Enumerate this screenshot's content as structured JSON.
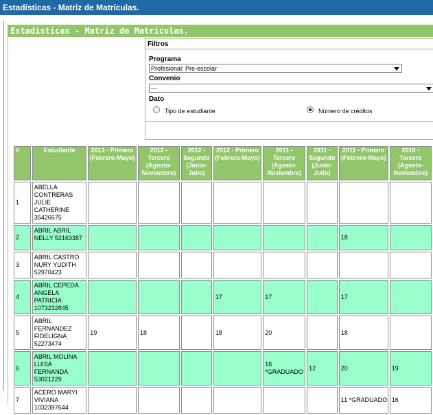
{
  "window": {
    "title": "Estadísticas - Matriz de Matrículas."
  },
  "panel": {
    "title": "Estadísticas - Matriz de Matrículas."
  },
  "filters": {
    "title": "Filtros",
    "programa_label": "Programa",
    "programa_value": "Profesional: Pre-escolar",
    "convenio_label": "Convenio",
    "convenio_value": "---",
    "dato_label": "Dato",
    "option_tipo": "Tipo de estudiante",
    "option_numero": "Número de créditos",
    "selected": "numero"
  },
  "table": {
    "headers": [
      "#",
      "Estudiante",
      "2013 - Primero (Febrero-Mayo)",
      "2012 - Tercero (Agosto-Noviembre)",
      "2012 - Segundo (Junio-Julio)",
      "2012 - Primero (Febrero-Mayo)",
      "2011 - Tercero (Agosto-Noviembre)",
      "2011 - Segundo (Junio-Julio)",
      "2011 - Primero (Febrero-Mayo)",
      "2010 - Tercero (Agosto-Noviembre)"
    ],
    "rows": [
      {
        "num": "1",
        "name": "ABELLA CONTRERAS JULIE CATHERINE 35426675",
        "cells": [
          "",
          "",
          "",
          "",
          "",
          "",
          "",
          ""
        ]
      },
      {
        "num": "2",
        "name": "ABRIL ABRIL NELLY 52163387",
        "cells": [
          "",
          "",
          "",
          "",
          "",
          "",
          "18",
          ""
        ]
      },
      {
        "num": "3",
        "name": "ABRIL CASTRO NURY YUDITH 52970423",
        "cells": [
          "",
          "",
          "",
          "",
          "",
          "",
          "",
          ""
        ]
      },
      {
        "num": "4",
        "name": "ABRIL CEPEDA ANGELA PATRICIA 1073232845",
        "cells": [
          "",
          "",
          "",
          "17",
          "17",
          "",
          "17",
          ""
        ]
      },
      {
        "num": "5",
        "name": "ABRIL FERNANDEZ FIDELIGNA 52273474",
        "cells": [
          "19",
          "18",
          "",
          "18",
          "20",
          "",
          "18",
          ""
        ]
      },
      {
        "num": "6",
        "name": "ABRIL MOLINA LUISA FERNANDA 53021229",
        "cells": [
          "",
          "",
          "",
          "",
          "16 *GRADUADO",
          "12",
          "20",
          "19"
        ]
      },
      {
        "num": "7",
        "name": "ACERO MARYI VIVIANA 1032397644",
        "cells": [
          "",
          "",
          "",
          "",
          "",
          "",
          "11 *GRADUADO",
          "16"
        ]
      }
    ]
  }
}
